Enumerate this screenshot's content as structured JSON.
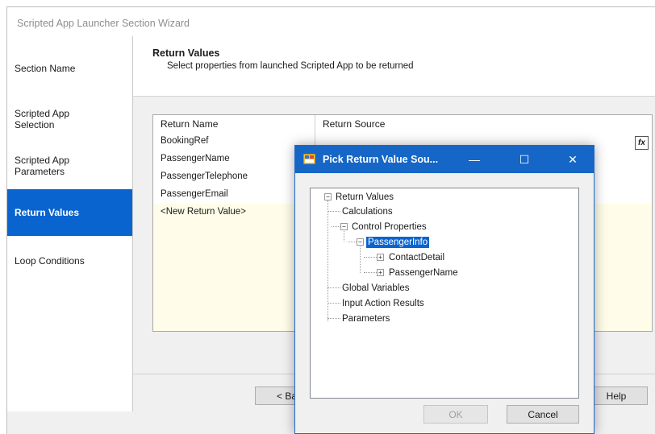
{
  "window": {
    "title": "Scripted App Launcher Section Wizard"
  },
  "nav": {
    "items": [
      {
        "label": "Section Name"
      },
      {
        "label": "Scripted App\nSelection"
      },
      {
        "label": "Scripted App\nParameters"
      },
      {
        "label": "Return Values",
        "active": true
      },
      {
        "label": "Loop Conditions"
      }
    ]
  },
  "header": {
    "title": "Return Values",
    "subtitle": "Select properties from launched Scripted App to be returned"
  },
  "grid": {
    "columns": [
      "Return Name",
      "Return Source"
    ],
    "rows": [
      "BookingRef",
      "PassengerName",
      "PassengerTelephone",
      "PassengerEmail"
    ],
    "new_row": "<New Return Value>",
    "source_button": "fx"
  },
  "footer": {
    "back": "< Ba",
    "help": "Help"
  },
  "dialog": {
    "title": "Pick Return Value Sou...",
    "minimize": "—",
    "maximize": "☐",
    "close": "✕",
    "tree": {
      "root": "Return Values",
      "calculations": "Calculations",
      "control_properties": "Control Properties",
      "passenger_info": "PassengerInfo",
      "contact_detail": "ContactDetail",
      "passenger_name": "PassengerName",
      "global_variables": "Global Variables",
      "input_action_results": "Input Action Results",
      "parameters": "Parameters"
    },
    "ok": "OK",
    "cancel": "Cancel"
  },
  "colors": {
    "accent": "#0a64cf",
    "dialog_bar": "#1566c6",
    "grid_bg": "#fffde9"
  }
}
